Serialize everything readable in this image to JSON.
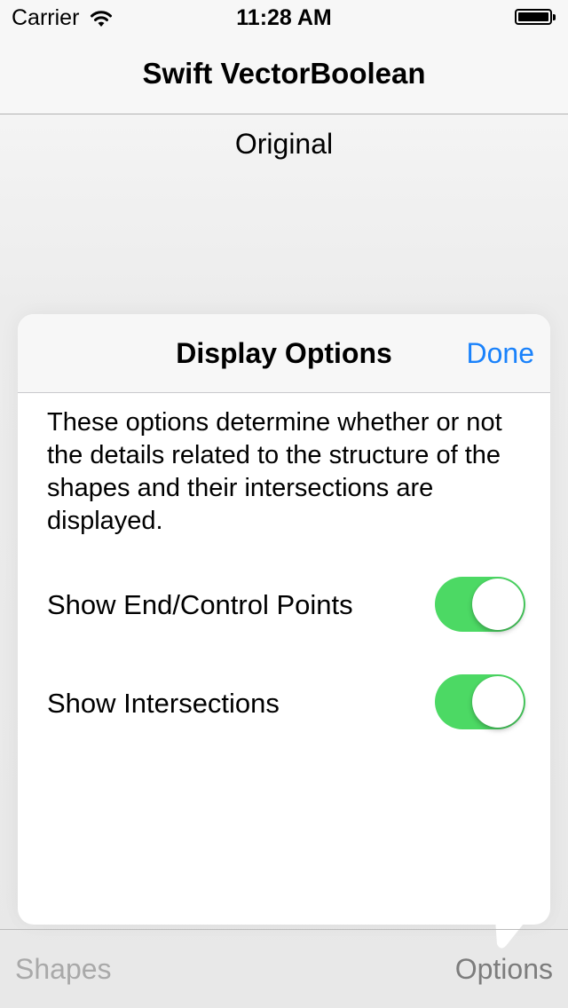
{
  "status_bar": {
    "carrier": "Carrier",
    "time": "11:28 AM",
    "wifi_icon": "wifi-icon",
    "battery_icon": "battery-icon"
  },
  "nav": {
    "title": "Swift VectorBoolean"
  },
  "main": {
    "section_label": "Original"
  },
  "popover": {
    "title": "Display Options",
    "done_label": "Done",
    "description": "These options determine whether or not the details related to the structure of the shapes and their intersections are displayed.",
    "options": [
      {
        "label": "Show End/Control Points",
        "enabled": true
      },
      {
        "label": "Show Intersections",
        "enabled": true
      }
    ]
  },
  "toolbar": {
    "left_label": "Shapes",
    "right_label": "Options"
  },
  "colors": {
    "accent": "#1a82fb",
    "toggle_on": "#4cd964",
    "toolbar_disabled": "#a9a9a9",
    "toolbar_text": "#7d7d7d"
  }
}
